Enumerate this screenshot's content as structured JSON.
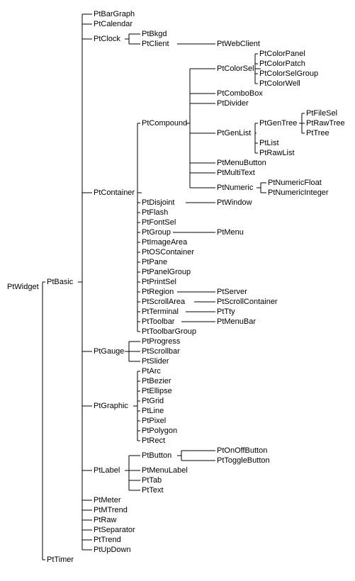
{
  "tree": {
    "name": "PtWidget",
    "children": [
      {
        "name": "PtBasic",
        "children": [
          {
            "name": "PtBarGraph"
          },
          {
            "name": "PtCalendar"
          },
          {
            "name": "PtClock",
            "children": [
              {
                "name": "PtBkgd"
              },
              {
                "name": "PtClient",
                "children": [
                  {
                    "name": "PtWebClient"
                  }
                ]
              }
            ]
          },
          {
            "name": "PtContainer",
            "children": [
              {
                "name": "PtCompound",
                "children": [
                  {
                    "name": "PtColorSel",
                    "children": [
                      {
                        "name": "PtColorPanel"
                      },
                      {
                        "name": "PtColorPatch"
                      },
                      {
                        "name": "PtColorSelGroup"
                      },
                      {
                        "name": "PtColorWell"
                      }
                    ]
                  },
                  {
                    "name": "PtComboBox"
                  },
                  {
                    "name": "PtDivider"
                  },
                  {
                    "name": "PtGenList",
                    "children": [
                      {
                        "name": "PtGenTree",
                        "children": [
                          {
                            "name": "PtFileSel"
                          },
                          {
                            "name": "PtRawTree"
                          },
                          {
                            "name": "PtTree"
                          }
                        ]
                      },
                      {
                        "name": "PtList"
                      },
                      {
                        "name": "PtRawList"
                      }
                    ]
                  },
                  {
                    "name": "PtMenuButton"
                  },
                  {
                    "name": "PtMultiText"
                  },
                  {
                    "name": "PtNumeric",
                    "children": [
                      {
                        "name": "PtNumericFloat"
                      },
                      {
                        "name": "PtNumericInteger"
                      }
                    ]
                  }
                ]
              },
              {
                "name": "PtDisjoint",
                "children": [
                  {
                    "name": "PtWindow"
                  }
                ]
              },
              {
                "name": "PtFlash"
              },
              {
                "name": "PtFontSel"
              },
              {
                "name": "PtGroup",
                "children": [
                  {
                    "name": "PtMenu"
                  }
                ]
              },
              {
                "name": "PtImageArea"
              },
              {
                "name": "PtOSContainer"
              },
              {
                "name": "PtPane"
              },
              {
                "name": "PtPanelGroup"
              },
              {
                "name": "PtPrintSel"
              },
              {
                "name": "PtRegion",
                "children": [
                  {
                    "name": "PtServer"
                  }
                ]
              },
              {
                "name": "PtScrollArea",
                "children": [
                  {
                    "name": "PtScrollContainer"
                  }
                ]
              },
              {
                "name": "PtTerminal",
                "children": [
                  {
                    "name": "PtTty"
                  }
                ]
              },
              {
                "name": "PtToolbar",
                "children": [
                  {
                    "name": "PtMenuBar"
                  }
                ]
              },
              {
                "name": "PtToolbarGroup"
              }
            ]
          },
          {
            "name": "PtGauge",
            "children": [
              {
                "name": "PtProgress"
              },
              {
                "name": "PtScrollbar"
              },
              {
                "name": "PtSlider"
              }
            ]
          },
          {
            "name": "PtGraphic",
            "children": [
              {
                "name": "PtArc"
              },
              {
                "name": "PtBezier"
              },
              {
                "name": "PtEllipse"
              },
              {
                "name": "PtGrid"
              },
              {
                "name": "PtLine"
              },
              {
                "name": "PtPixel"
              },
              {
                "name": "PtPolygon"
              },
              {
                "name": "PtRect"
              }
            ]
          },
          {
            "name": "PtLabel",
            "children": [
              {
                "name": "PtButton",
                "children": [
                  {
                    "name": "PtOnOffButton"
                  },
                  {
                    "name": "PtToggleButton"
                  }
                ]
              },
              {
                "name": "PtMenuLabel"
              },
              {
                "name": "PtTab"
              },
              {
                "name": "PtText"
              }
            ]
          },
          {
            "name": "PtMeter"
          },
          {
            "name": "PtMTrend"
          },
          {
            "name": "PtRaw"
          },
          {
            "name": "PtSeparator"
          },
          {
            "name": "PtTrend"
          },
          {
            "name": "PtUpDown"
          }
        ]
      },
      {
        "name": "PtTimer"
      }
    ]
  },
  "layout": {
    "line_height": 14,
    "char_width": 6,
    "tick": 6
  }
}
